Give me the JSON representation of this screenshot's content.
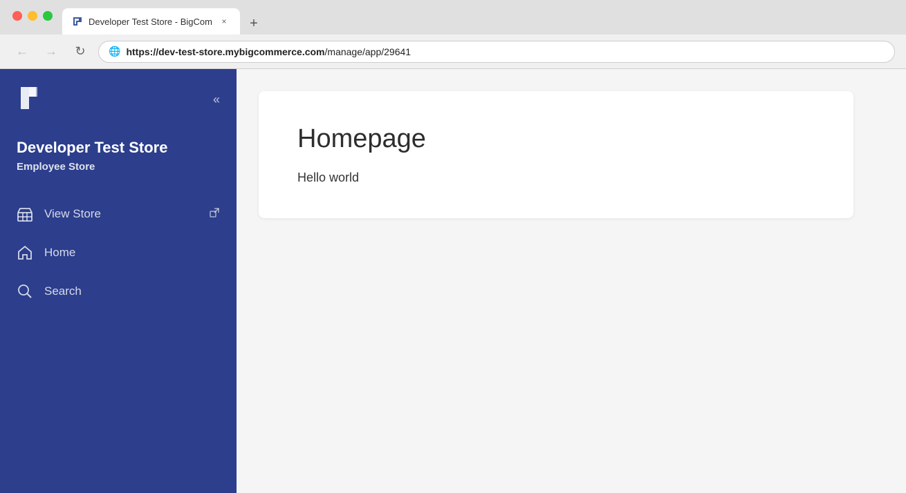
{
  "browser": {
    "tab_title": "Developer Test Store - BigCom",
    "tab_close_label": "×",
    "tab_new_label": "+",
    "url": "https://dev-test-store.mybigcommerce.com/manage/app/29641",
    "url_bold_part": "https://dev-test-store.mybigcommerce.com",
    "url_rest": "/manage/app/29641"
  },
  "nav": {
    "back_label": "←",
    "forward_label": "→",
    "reload_label": "↻"
  },
  "sidebar": {
    "logo_alt": "BigCommerce",
    "collapse_label": "«",
    "store_name": "Developer Test Store",
    "store_type": "Employee Store",
    "nav_items": [
      {
        "id": "view-store",
        "label": "View Store",
        "icon": "store",
        "external": true
      },
      {
        "id": "home",
        "label": "Home",
        "icon": "home"
      },
      {
        "id": "search",
        "label": "Search",
        "icon": "search"
      }
    ]
  },
  "main": {
    "card_title": "Homepage",
    "card_body": "Hello world"
  }
}
